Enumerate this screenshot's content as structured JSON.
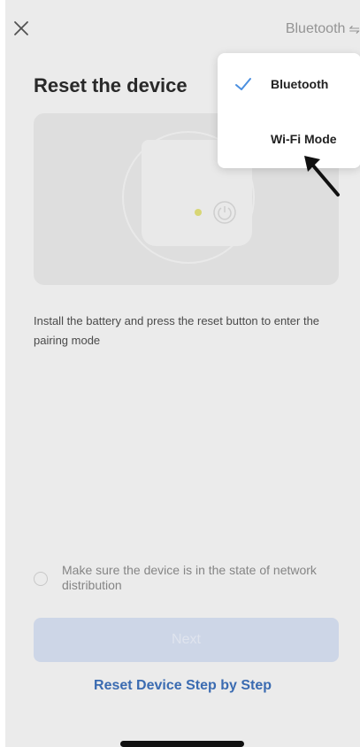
{
  "header": {
    "mode_label": "Bluetooth",
    "mode_switch_glyph": "⇋"
  },
  "title": "Reset the device",
  "instruction": "Install the battery and press the reset button to enter the pairing mode",
  "confirm": {
    "text": "Make sure the device is in the state of network distribution",
    "checked": false
  },
  "next_button": {
    "label": "Next",
    "enabled": false
  },
  "reset_link": "Reset Device Step by Step",
  "dropdown": {
    "items": [
      {
        "label": "Bluetooth",
        "selected": true
      },
      {
        "label": "Wi-Fi Mode",
        "selected": false
      }
    ]
  },
  "colors": {
    "accent": "#3d6fb8",
    "check": "#4a8fe0",
    "button_disabled": "#d5def0"
  },
  "icons": [
    "close-icon",
    "swap-icon",
    "check-icon",
    "power-icon",
    "cursor-arrow-icon"
  ]
}
